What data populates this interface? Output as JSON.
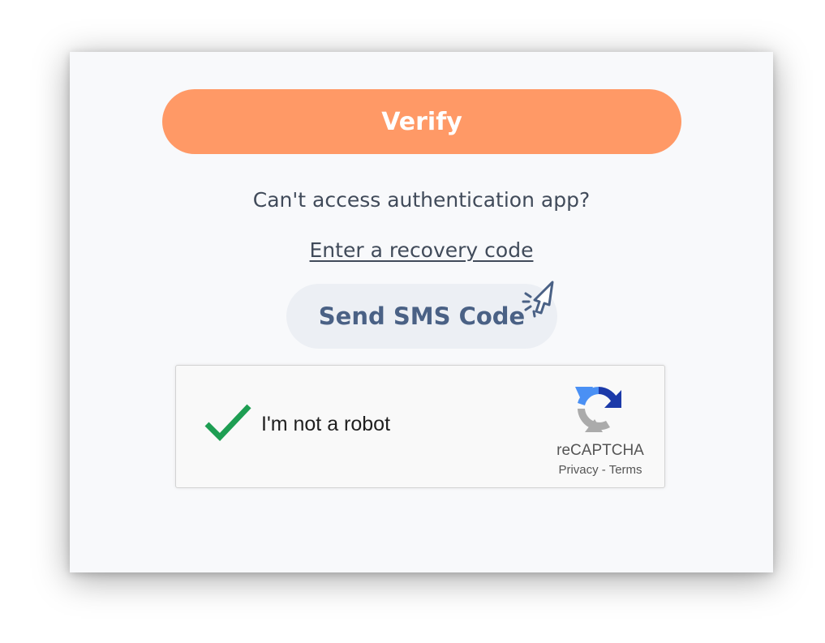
{
  "verify": {
    "label": "Verify",
    "color": "#ff9966"
  },
  "auth": {
    "question": "Can't access authentication app?",
    "recovery_link": "Enter a recovery code"
  },
  "sms": {
    "label": "Send SMS Code",
    "color": "#4a6185"
  },
  "captcha": {
    "checkbox_label": "I'm not a robot",
    "checked": true,
    "brand": "reCAPTCHA",
    "privacy": "Privacy",
    "separator": " - ",
    "terms": "Terms",
    "check_color": "#1e9e53"
  },
  "icons": {
    "cursor": "click-cursor-icon",
    "check": "checkmark-icon",
    "logo": "recaptcha-logo-icon"
  }
}
